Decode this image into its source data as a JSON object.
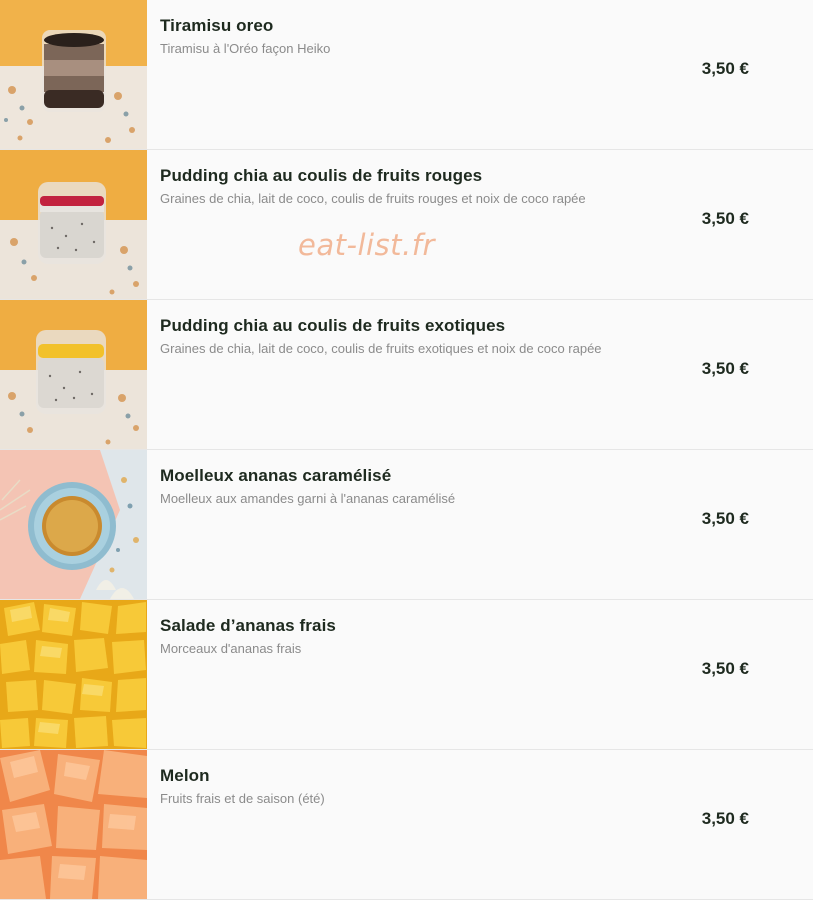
{
  "items": [
    {
      "name": "Tiramisu oreo",
      "description": "Tiramisu à l'Oréo façon Heiko",
      "price": "3,50 €",
      "image": "tiramisu-glass-photo"
    },
    {
      "name": "Pudding chia au coulis de fruits rouges",
      "description": "Graines de chia, lait de coco, coulis de fruits rouges et noix de coco rapée",
      "price": "3,50 €",
      "image": "chia-pudding-red-photo"
    },
    {
      "name": "Pudding chia au coulis de fruits exotiques",
      "description": "Graines de chia, lait de coco, coulis de fruits exotiques et noix de coco rapée",
      "price": "3,50 €",
      "image": "chia-pudding-exotic-photo"
    },
    {
      "name": "Moelleux ananas caramélisé",
      "description": "Moelleux aux amandes garni à l'ananas caramélisé",
      "price": "3,50 €",
      "image": "pineapple-cake-photo"
    },
    {
      "name": "Salade d’ananas frais",
      "description": "Morceaux d'ananas frais",
      "price": "3,50 €",
      "image": "pineapple-chunks-photo"
    },
    {
      "name": "Melon",
      "description": "Fruits frais et de saison (été)",
      "price": "3,50 €",
      "image": "melon-slices-photo"
    }
  ],
  "watermark": "eat-list.fr",
  "colors": {
    "row_bg": "#fafafa",
    "title": "#1e2a1f",
    "description": "#8b8b8b",
    "divider": "#e6e6e6",
    "watermark": "#f2b99a"
  }
}
